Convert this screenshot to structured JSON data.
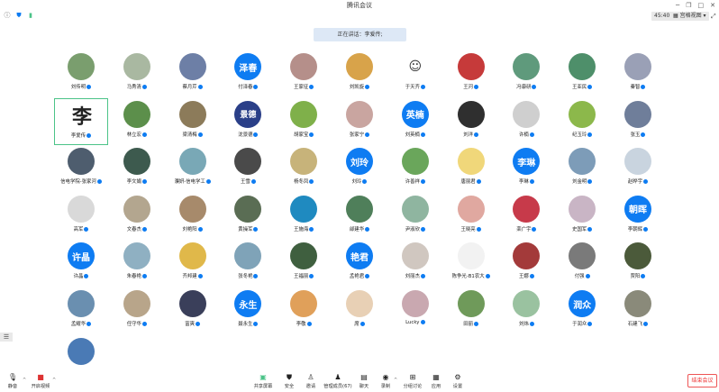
{
  "app": {
    "title": "腾讯会议"
  },
  "window": {
    "min": "─",
    "restore": "❐",
    "max": "□",
    "close": "✕"
  },
  "info": {
    "timer": "45:40",
    "view_label": "宫格视图",
    "view_caret": "▾",
    "fullscreen": "⤢"
  },
  "speaking": {
    "text": "正在讲话：李爱传;"
  },
  "sidebar_toggle": "☰",
  "participants": [
    {
      "name": "刘传明",
      "type": "photo",
      "color": "#7a9e6e"
    },
    {
      "name": "马秀清",
      "type": "photo",
      "color": "#a9b8a1"
    },
    {
      "name": "蔡月芹",
      "type": "photo",
      "color": "#6d7fa6"
    },
    {
      "name": "付泽春",
      "type": "text",
      "label": "泽春"
    },
    {
      "name": "王家征",
      "type": "photo",
      "color": "#b58f8a"
    },
    {
      "name": "刘凯旋",
      "type": "photo",
      "color": "#d8a34a"
    },
    {
      "name": "于天齐",
      "type": "smile",
      "label": "☺"
    },
    {
      "name": "王河",
      "type": "photo",
      "color": "#c63a3a"
    },
    {
      "name": "冯康研",
      "type": "photo",
      "color": "#5f9a7c"
    },
    {
      "name": "王亚民",
      "type": "photo",
      "color": "#4e8f6a"
    },
    {
      "name": "秦智",
      "type": "photo",
      "color": "#9aa0b6"
    },
    {
      "name": "李爱传",
      "type": "sq",
      "label": "李"
    },
    {
      "name": "林立宏",
      "type": "photo",
      "color": "#5c8f4b"
    },
    {
      "name": "梁清梅",
      "type": "photo",
      "color": "#8c7b5a"
    },
    {
      "name": "沈景德",
      "type": "brand",
      "label": "景德",
      "color": "#2a3f88"
    },
    {
      "name": "胡家宝",
      "type": "photo",
      "color": "#7fb04a"
    },
    {
      "name": "张家宁",
      "type": "photo",
      "color": "#c9a5a0"
    },
    {
      "name": "刘英楠",
      "type": "text",
      "label": "英楠"
    },
    {
      "name": "刘洋",
      "type": "photo",
      "color": "#2f2f2f"
    },
    {
      "name": "许楠",
      "type": "photo",
      "color": "#cfcfcf"
    },
    {
      "name": "纪玉玲",
      "type": "photo",
      "color": "#8cb84b"
    },
    {
      "name": "张玉",
      "type": "photo",
      "color": "#6f7e9a"
    },
    {
      "name": "信电学院-张家河",
      "type": "photo",
      "color": "#4e5d6e"
    },
    {
      "name": "李文娟",
      "type": "photo",
      "color": "#3d5a4e"
    },
    {
      "name": "濮妍-信电学工",
      "type": "photo",
      "color": "#79a8b6"
    },
    {
      "name": "王雪",
      "type": "photo",
      "color": "#4a4a4a"
    },
    {
      "name": "杨冬凤",
      "type": "photo",
      "color": "#c7b37a"
    },
    {
      "name": "刘玲",
      "type": "text",
      "label": "刘玲"
    },
    {
      "name": "许善祥",
      "type": "photo",
      "color": "#6aa65b"
    },
    {
      "name": "唐丽君",
      "type": "photo",
      "color": "#f0d77a"
    },
    {
      "name": "李琳",
      "type": "text",
      "label": "李琳"
    },
    {
      "name": "刘金明",
      "type": "photo",
      "color": "#7d9cb8"
    },
    {
      "name": "赵晔宇",
      "type": "photo",
      "color": "#c9d4df"
    },
    {
      "name": "高军",
      "type": "photo",
      "color": "#d9d9d9"
    },
    {
      "name": "文春杰",
      "type": "photo",
      "color": "#b3a68f"
    },
    {
      "name": "刘艳阳",
      "type": "photo",
      "color": "#a78a6b"
    },
    {
      "name": "黄操军",
      "type": "photo",
      "color": "#5a6d54"
    },
    {
      "name": "王施海",
      "type": "photo",
      "color": "#1f8ac0"
    },
    {
      "name": "邰建华",
      "type": "photo",
      "color": "#4f7f5a"
    },
    {
      "name": "尹淑欣",
      "type": "photo",
      "color": "#8fb5a0"
    },
    {
      "name": "王晓亮",
      "type": "photo",
      "color": "#e0a8a0"
    },
    {
      "name": "栾广宇",
      "type": "photo",
      "color": "#c73a4a"
    },
    {
      "name": "史国军",
      "type": "photo",
      "color": "#c9b5c5"
    },
    {
      "name": "李朝辉",
      "type": "text",
      "label": "朝晖"
    },
    {
      "name": "许晶",
      "type": "text",
      "label": "许晶"
    },
    {
      "name": "朱春艳",
      "type": "photo",
      "color": "#8fb0c2"
    },
    {
      "name": "齐邦建",
      "type": "photo",
      "color": "#e0b84a"
    },
    {
      "name": "张冬艳",
      "type": "photo",
      "color": "#7fa3b8"
    },
    {
      "name": "王福丽",
      "type": "photo",
      "color": "#3f5f3f"
    },
    {
      "name": "孟艳君",
      "type": "text",
      "label": "艳君"
    },
    {
      "name": "刘丽杰",
      "type": "photo",
      "color": "#d0c7c0"
    },
    {
      "name": "陈争光-B1农大",
      "type": "photo",
      "color": "#f2f2f2"
    },
    {
      "name": "王娜",
      "type": "photo",
      "color": "#a33a3a"
    },
    {
      "name": "付强",
      "type": "photo",
      "color": "#7a7a7a"
    },
    {
      "name": "贾阳",
      "type": "photo",
      "color": "#4b5a3a"
    },
    {
      "name": "孟耀华",
      "type": "photo",
      "color": "#6a8fb0"
    },
    {
      "name": "任守华",
      "type": "photo",
      "color": "#b8a58a"
    },
    {
      "name": "富爽",
      "type": "photo",
      "color": "#3a3f5a"
    },
    {
      "name": "聂永生",
      "type": "text",
      "label": "永生"
    },
    {
      "name": "李敬",
      "type": "photo",
      "color": "#e0a05a"
    },
    {
      "name": "席",
      "type": "photo",
      "color": "#e8d0b5"
    },
    {
      "name": "Lucky",
      "type": "photo",
      "color": "#c9a8b0"
    },
    {
      "name": "田丽",
      "type": "photo",
      "color": "#6f9a5a"
    },
    {
      "name": "刘炜",
      "type": "photo",
      "color": "#9ac2a0"
    },
    {
      "name": "于润众",
      "type": "text",
      "label": "润众"
    },
    {
      "name": "石建飞",
      "type": "photo",
      "color": "#8a8a7a"
    },
    {
      "name": "",
      "type": "photo",
      "color": "#4a7ab5"
    }
  ],
  "toolbar": {
    "mute": "静音",
    "video": "开启视频",
    "share": "共享屏幕",
    "security": "安全",
    "invite": "邀请",
    "members": "管理成员(67)",
    "chat": "聊天",
    "record": "录制",
    "breakout": "分组讨论",
    "apps": "应用",
    "settings": "设置",
    "end": "结束会议"
  },
  "colors": {
    "accent": "#0e7cf2",
    "selected": "#4bc388",
    "end": "#e33333"
  }
}
